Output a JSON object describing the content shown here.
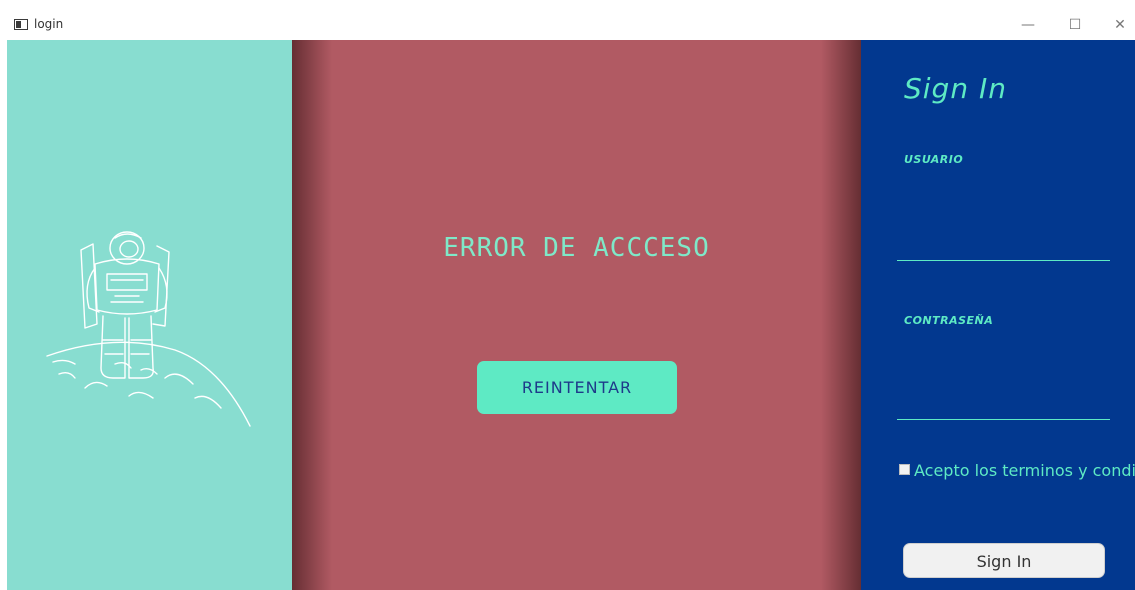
{
  "window": {
    "title": "login",
    "minimize": "—",
    "maximize": "☐",
    "close": "✕"
  },
  "center": {
    "error_message": "ERROR DE ACCCESO",
    "retry_label": "REINTENTAR"
  },
  "right": {
    "heading": "Sign In",
    "user_label": "USUARIO",
    "user_value": "",
    "password_label": "CONTRASEÑA",
    "password_value": "",
    "terms_label": "Acepto los terminos y condiciones",
    "terms_checked": false,
    "signin_label": "Sign In"
  },
  "colors": {
    "left_bg": "#88DDD0",
    "center_bg": "#B15A63",
    "right_bg": "#02388F",
    "accent": "#5EEAC4",
    "retry_text": "#1E3A8A"
  },
  "icons": {
    "app": "window-app-icon",
    "illustration": "astronaut-on-planet-illustration"
  }
}
